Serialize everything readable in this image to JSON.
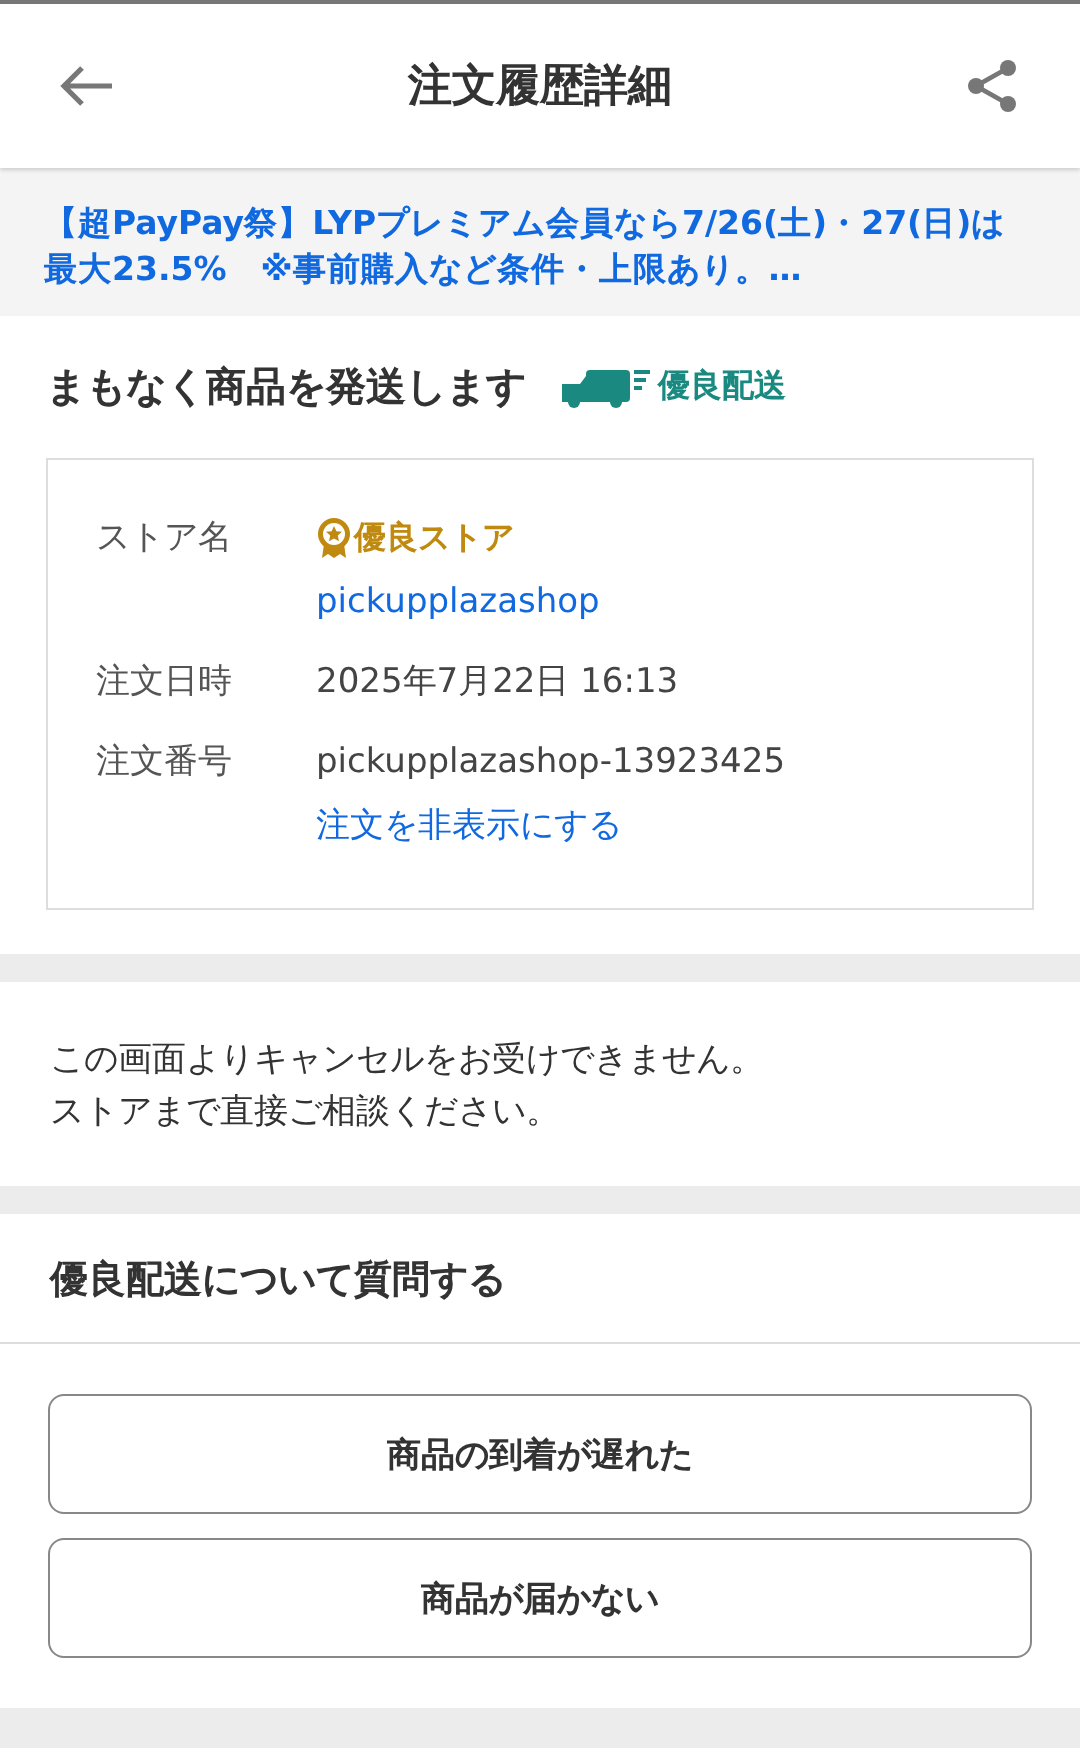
{
  "header": {
    "title": "注文履歴詳細"
  },
  "banner": {
    "text": "【超PayPay祭】LYPプレミアム会員なら7/26(土)・27(日)は最大23.5%　※事前購入など条件・上限あり。…"
  },
  "status": {
    "title": "まもなく商品を発送します",
    "badge": "優良配送"
  },
  "details": [
    {
      "label": "ストア名",
      "lines": [
        {
          "kind": "badge",
          "text": "優良ストア"
        },
        {
          "kind": "link",
          "text": "pickupplazashop"
        }
      ]
    },
    {
      "label": "注文日時",
      "lines": [
        {
          "kind": "text",
          "text": "2025年7月22日 16:13"
        }
      ]
    },
    {
      "label": "注文番号",
      "lines": [
        {
          "kind": "text",
          "text": "pickupplazashop-13923425"
        },
        {
          "kind": "link",
          "text": "注文を非表示にする"
        }
      ]
    }
  ],
  "notice": [
    "この画面よりキャンセルをお受けできません。",
    "ストアまで直接ご相談ください。"
  ],
  "question": {
    "title": "優良配送について質問する",
    "buttons": [
      "商品の到着が遅れた",
      "商品が届かない"
    ]
  }
}
